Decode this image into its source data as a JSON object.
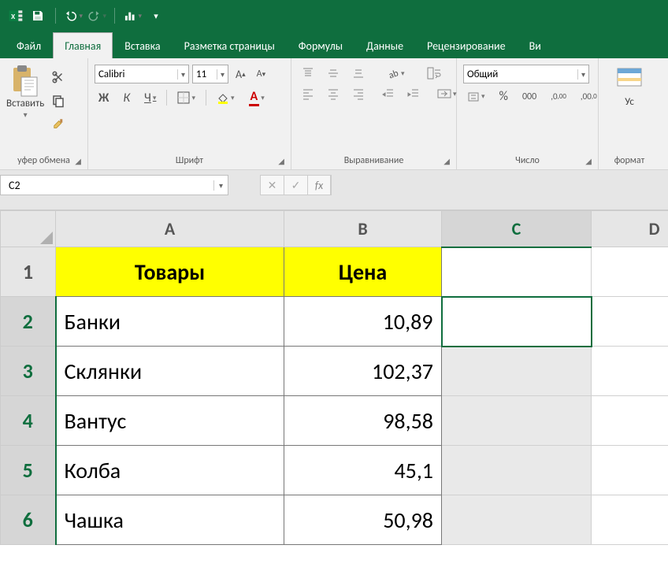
{
  "qat": {
    "chart_tip": "Chart",
    "customize_tip": "Customize"
  },
  "tabs": {
    "file": "Файл",
    "home": "Главная",
    "insert": "Вставка",
    "layout": "Разметка страницы",
    "formulas": "Формулы",
    "data": "Данные",
    "review": "Рецензирование",
    "view_partial": "Ви"
  },
  "ribbon": {
    "clipboard": {
      "paste": "Вставить",
      "group": "уфер обмена"
    },
    "font": {
      "name": "Calibri",
      "size": "11",
      "group": "Шрифт",
      "bold": "Ж",
      "italic": "К",
      "underline": "Ч"
    },
    "align": {
      "group": "Выравнивание"
    },
    "number": {
      "format": "Общий",
      "group": "Число",
      "pct": "%",
      "comma": "000"
    },
    "cond": {
      "line1": "Ус",
      "line2": "формат"
    }
  },
  "formula_bar": {
    "name_box": "C2",
    "fx": "fx",
    "cancel": "✕",
    "enter": "✓"
  },
  "sheet": {
    "cols": [
      "A",
      "B",
      "C",
      "D"
    ],
    "rows": [
      "1",
      "2",
      "3",
      "4",
      "5",
      "6"
    ],
    "headers": {
      "a": "Товары",
      "b": "Цена"
    }
  },
  "chart_data": {
    "type": "table",
    "columns": [
      "Товары",
      "Цена"
    ],
    "rows": [
      {
        "name": "Банки",
        "price": "10,89",
        "price_num": 10.89
      },
      {
        "name": "Склянки",
        "price": "102,37",
        "price_num": 102.37
      },
      {
        "name": "Вантус",
        "price": "98,58",
        "price_num": 98.58
      },
      {
        "name": "Колба",
        "price": "45,1",
        "price_num": 45.1
      },
      {
        "name": "Чашка",
        "price": "50,98",
        "price_num": 50.98
      }
    ]
  }
}
